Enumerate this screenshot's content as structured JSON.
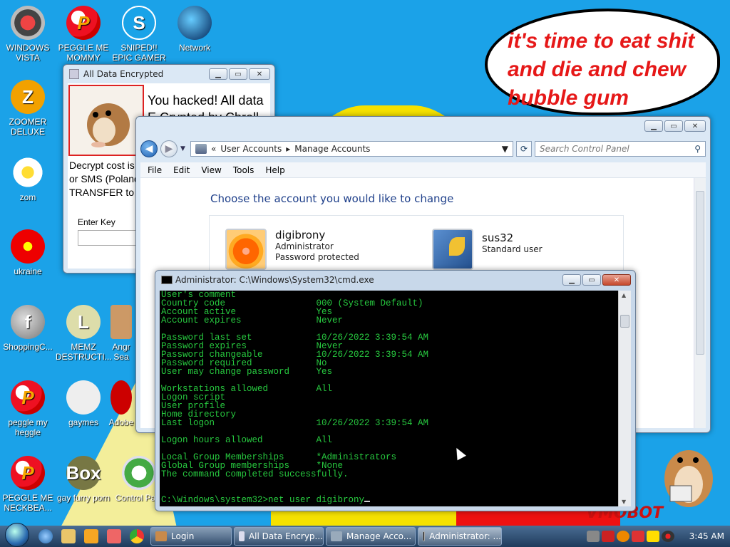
{
  "speech_bubble": {
    "text": "it's time to eat shit and die and chew bubble gum"
  },
  "wallpaper": {
    "watermark": "VMOBOT"
  },
  "desktop_icons": [
    {
      "label": "WINDOWS VISTA",
      "icon": "vista-icon"
    },
    {
      "label": "PEGGLE ME MOMMY",
      "icon": "peggle-icon"
    },
    {
      "label": "SNIPED!! EPIC GAMER 360...",
      "icon": "skype-icon"
    },
    {
      "label": "Network",
      "icon": "network-icon"
    },
    {
      "label": "ZOOMER DELUXE",
      "icon": "zoomer-icon"
    },
    {
      "label": "zom",
      "icon": "flower-icon"
    },
    {
      "label": "ukraine",
      "icon": "radiation-icon"
    },
    {
      "label": "ShoppingC...",
      "icon": "flash-icon"
    },
    {
      "label": "MEMZ DESTRUCTI...",
      "icon": "memz-icon"
    },
    {
      "label": "Angr Sea",
      "icon": "angry-icon"
    },
    {
      "label": "peggle my heggle",
      "icon": "peggle-icon"
    },
    {
      "label": "gaymes",
      "icon": "book-icon"
    },
    {
      "label": "Adobe",
      "icon": "adobe-icon"
    },
    {
      "label": "PEGGLE ME NECKBEA...",
      "icon": "peggle-icon"
    },
    {
      "label": "gay furry porn",
      "icon": "box-icon"
    },
    {
      "label": "Control Pa...",
      "icon": "control-panel-icon"
    }
  ],
  "ransom_window": {
    "title": "All Data Encrypted",
    "message_line1": "You hacked! All data",
    "message_line2": "E   Crypted by Chroll",
    "body_lines": [
      "Decrypt cost is",
      "or SMS (Poland",
      "TRANSFER to 7"
    ],
    "enter_key_label": "Enter Key",
    "enter_key_value": ""
  },
  "control_panel": {
    "crumb_prefix": "«",
    "breadcrumb": [
      "User Accounts",
      "Manage Accounts"
    ],
    "search_placeholder": "Search Control Panel",
    "menu": [
      "File",
      "Edit",
      "View",
      "Tools",
      "Help"
    ],
    "heading": "Choose the account you would like to change",
    "accounts": [
      {
        "name": "digibrony",
        "type": "Administrator",
        "status": "Password protected"
      },
      {
        "name": "sus32",
        "type": "Standard user",
        "status": ""
      }
    ]
  },
  "cmd_window": {
    "title": "Administrator: C:\\Windows\\System32\\cmd.exe",
    "lines": [
      "User's comment",
      "Country code                 000 (System Default)",
      "Account active               Yes",
      "Account expires              Never",
      "",
      "Password last set            10/26/2022 3:39:54 AM",
      "Password expires             Never",
      "Password changeable          10/26/2022 3:39:54 AM",
      "Password required            No",
      "User may change password     Yes",
      "",
      "Workstations allowed         All",
      "Logon script",
      "User profile",
      "Home directory",
      "Last logon                   10/26/2022 3:39:54 AM",
      "",
      "Logon hours allowed          All",
      "",
      "Local Group Memberships      *Administrators",
      "Global Group memberships     *None",
      "The command completed successfully.",
      "",
      "",
      "C:\\Windows\\system32>net user digibrony"
    ]
  },
  "taskbar": {
    "tasks": [
      {
        "label": "Login",
        "icon": "login-icon"
      },
      {
        "label": "All Data Encryp...",
        "icon": "ransom-icon"
      },
      {
        "label": "Manage Acco...",
        "icon": "control-panel-icon"
      },
      {
        "label": "Administrator: ...",
        "icon": "cmd-icon"
      }
    ],
    "clock": "3:45 AM"
  },
  "colors": {
    "desktop": "#1ba2e8",
    "cmd_text": "#27c93f",
    "speech_text": "#e61818",
    "cp_heading": "#1e3f8a"
  }
}
